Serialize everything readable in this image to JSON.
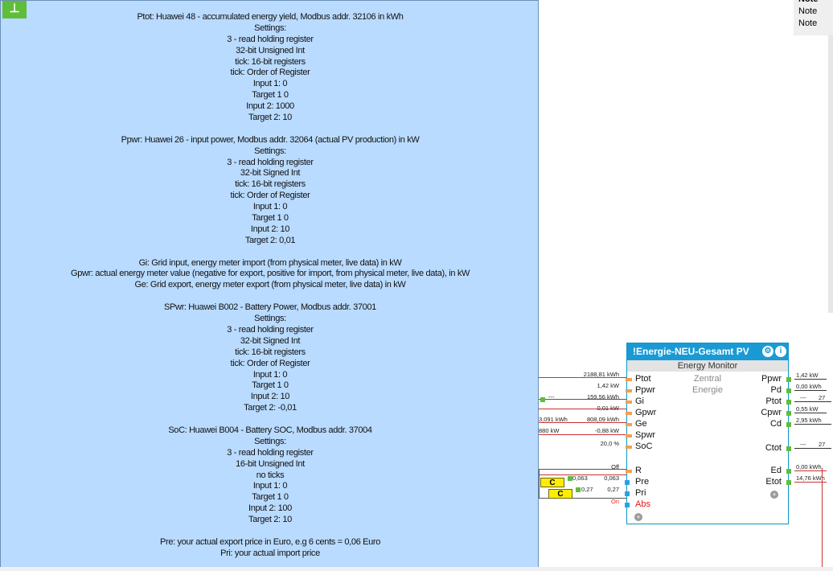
{
  "note": {
    "pin_icon": "pin-icon",
    "lines": [
      "Ptot: Huawei 48 - accumulated energy yield, Modbus addr. 32106 in kWh",
      "Settings:",
      "3 - read holding register",
      "32-bit Unsigned Int",
      "tick: 16-bit registers",
      "tick: Order of Register",
      "Input 1: 0",
      "Target 1 0",
      "Input 2: 1000",
      "Target 2: 10",
      "",
      "Ppwr: Huawei 26 - input power, Modbus addr. 32064 (actual PV production) in kW",
      "Settings:",
      "3 - read holding register",
      "32-bit Signed Int",
      "tick: 16-bit registers",
      "tick: Order of Register",
      "Input 1: 0",
      "Target 1 0",
      "Input 2: 10",
      "Target 2: 0,01",
      "",
      "Gi: Grid input, energy meter import (from physical meter, live data) in kW",
      "Gpwr: actual energy meter value (negative for export, positive for import, from physical meter, live data), in kW",
      "Ge: Grid export, energy meter export (from physical meter, live data) in kW",
      "",
      "SPwr: Huawei B002 - Battery Power, Modbus addr. 37001",
      "Settings:",
      "3 - read holding register",
      "32-bit Signed Int",
      "tick: 16-bit registers",
      "tick: Order of Register",
      "Input 1: 0",
      "Target 1 0",
      "Input 2: 10",
      "Target 2: -0,01",
      "",
      "SoC: Huawei B004 - Battery SOC, Modbus addr. 37004",
      "Settings:",
      "3 - read holding register",
      "16-bit Unsigned Int",
      "no ticks",
      "Input 1: 0",
      "Target 1 0",
      "Input 2: 100",
      "Target 2: 10",
      "",
      "Pre: your actual export price in Euro, e.g 6 cents = 0,06 Euro",
      "Pri: your actual import price"
    ]
  },
  "side_notes": [
    "Note",
    "Note",
    "Note"
  ],
  "block": {
    "title": "!Energie-NEU-Gesamt PV",
    "subtitle": "Energy Monitor",
    "center_text": [
      "Zentral",
      "Energie"
    ],
    "inputs": [
      "Ptot",
      "Ppwr",
      "Gi",
      "Gpwr",
      "Ge",
      "Spwr",
      "SoC",
      "R",
      "Pre",
      "Pri",
      "Abs"
    ],
    "outputs": [
      "Ppwr",
      "Pd",
      "Ptot",
      "Cpwr",
      "Cd",
      "Ctot",
      "Ed",
      "Etot"
    ],
    "input_values": {
      "ptot": "2188,81 kWh",
      "ppwr": "1,42 kW",
      "gi_left": "---",
      "gi": "159,56 kWh",
      "gpwr": "0,01 kW",
      "ge_left": "3,091 kWh",
      "ge": "808,09 kWh",
      "spwr_left": "880 kW",
      "spwr": "-0,88 kW",
      "soc": "20,0 %",
      "r": "Off",
      "pre_left": "0,063",
      "pre": "0,063",
      "pri_left": "0,27",
      "pri": "0,27",
      "abs": "On"
    },
    "output_values": {
      "ppwr": "1,42 kW",
      "pd": "0,00 kWh",
      "ptot_dash": "---",
      "ptot": "27",
      "cpwr": "0,55 kW",
      "cd": "2,95 kWh",
      "ctot_dash": "---",
      "ctot": "27",
      "ed": "0,00 kWh",
      "etot": "14,76 kWh"
    }
  },
  "c_blocks": [
    "C",
    "C"
  ]
}
